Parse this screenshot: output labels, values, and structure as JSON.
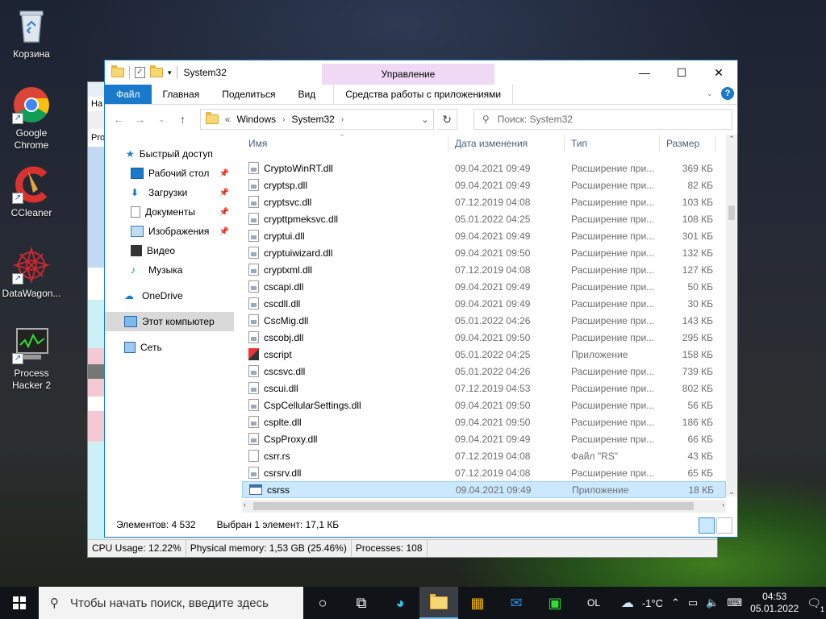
{
  "desktop": {
    "icons": [
      {
        "label": "Корзина"
      },
      {
        "label": "Google Chrome"
      },
      {
        "label": "CCleaner"
      },
      {
        "label": "DataWagon..."
      },
      {
        "label": "Process Hacker 2"
      }
    ]
  },
  "process_hacker": {
    "status": {
      "cpu": "CPU Usage: 12.22%",
      "memory": "Physical memory: 1,53 GB (25.46%)",
      "processes": "Processes: 108"
    }
  },
  "explorer": {
    "title": "System32",
    "manage_tab": "Управление",
    "ribbon_tabs": {
      "file": "Файл",
      "home": "Главная",
      "share": "Поделиться",
      "view": "Вид",
      "app_tools": "Средства работы с приложениями"
    },
    "address": {
      "overflow": "«",
      "crumb1": "Windows",
      "crumb2": "System32"
    },
    "search_placeholder": "Поиск: System32",
    "nav": {
      "quick_access": "Быстрый доступ",
      "desktop": "Рабочий стол",
      "downloads": "Загрузки",
      "documents": "Документы",
      "pictures": "Изображения",
      "video": "Видео",
      "music": "Музыка",
      "onedrive": "OneDrive",
      "this_pc": "Этот компьютер",
      "network": "Сеть"
    },
    "columns": {
      "name": "Имя",
      "date": "Дата изменения",
      "type": "Тип",
      "size": "Размер"
    },
    "files": [
      {
        "name": "CryptoWinRT.dll",
        "date": "09.04.2021 09:49",
        "type": "Расширение при...",
        "size": "369 КБ",
        "icon": "dll"
      },
      {
        "name": "cryptsp.dll",
        "date": "09.04.2021 09:49",
        "type": "Расширение при...",
        "size": "82 КБ",
        "icon": "dll"
      },
      {
        "name": "cryptsvc.dll",
        "date": "07.12.2019 04:08",
        "type": "Расширение при...",
        "size": "103 КБ",
        "icon": "dll"
      },
      {
        "name": "crypttpmeksvc.dll",
        "date": "05.01.2022 04:25",
        "type": "Расширение при...",
        "size": "108 КБ",
        "icon": "dll"
      },
      {
        "name": "cryptui.dll",
        "date": "09.04.2021 09:49",
        "type": "Расширение при...",
        "size": "301 КБ",
        "icon": "dll"
      },
      {
        "name": "cryptuiwizard.dll",
        "date": "09.04.2021 09:50",
        "type": "Расширение при...",
        "size": "132 КБ",
        "icon": "dll"
      },
      {
        "name": "cryptxml.dll",
        "date": "07.12.2019 04:08",
        "type": "Расширение при...",
        "size": "127 КБ",
        "icon": "dll"
      },
      {
        "name": "cscapi.dll",
        "date": "09.04.2021 09:49",
        "type": "Расширение при...",
        "size": "50 КБ",
        "icon": "dll"
      },
      {
        "name": "cscdll.dll",
        "date": "09.04.2021 09:49",
        "type": "Расширение при...",
        "size": "30 КБ",
        "icon": "dll"
      },
      {
        "name": "CscMig.dll",
        "date": "05.01.2022 04:26",
        "type": "Расширение при...",
        "size": "143 КБ",
        "icon": "dll"
      },
      {
        "name": "cscobj.dll",
        "date": "09.04.2021 09:50",
        "type": "Расширение при...",
        "size": "295 КБ",
        "icon": "dll"
      },
      {
        "name": "cscript",
        "date": "05.01.2022 04:25",
        "type": "Приложение",
        "size": "158 КБ",
        "icon": "cscript"
      },
      {
        "name": "cscsvc.dll",
        "date": "05.01.2022 04:26",
        "type": "Расширение при...",
        "size": "739 КБ",
        "icon": "dll"
      },
      {
        "name": "cscui.dll",
        "date": "07.12.2019 04:53",
        "type": "Расширение при...",
        "size": "802 КБ",
        "icon": "dll"
      },
      {
        "name": "CspCellularSettings.dll",
        "date": "09.04.2021 09:50",
        "type": "Расширение при...",
        "size": "56 КБ",
        "icon": "dll"
      },
      {
        "name": "csplte.dll",
        "date": "09.04.2021 09:50",
        "type": "Расширение при...",
        "size": "186 КБ",
        "icon": "dll"
      },
      {
        "name": "CspProxy.dll",
        "date": "09.04.2021 09:49",
        "type": "Расширение при...",
        "size": "66 КБ",
        "icon": "dll"
      },
      {
        "name": "csrr.rs",
        "date": "07.12.2019 04:08",
        "type": "Файл \"RS\"",
        "size": "43 КБ",
        "icon": "file"
      },
      {
        "name": "csrsrv.dll",
        "date": "07.12.2019 04:08",
        "type": "Расширение при...",
        "size": "65 КБ",
        "icon": "dll"
      },
      {
        "name": "csrss",
        "date": "09.04.2021 09:49",
        "type": "Приложение",
        "size": "18 КБ",
        "icon": "app",
        "selected": true
      }
    ],
    "status": {
      "count": "Элементов: 4 532",
      "selection": "Выбран 1 элемент: 17,1 КБ"
    }
  },
  "taskbar": {
    "search_placeholder": "Чтобы начать поиск, введите здесь",
    "lang": "OL",
    "weather": "-1°C",
    "time": "04:53",
    "date": "05.01.2022",
    "notifications": "1"
  }
}
